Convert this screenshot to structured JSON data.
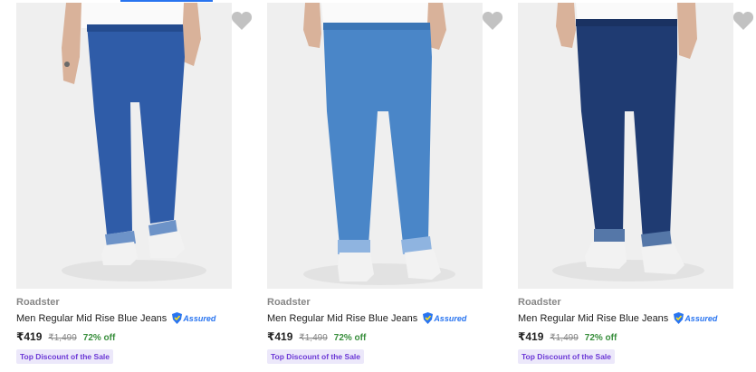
{
  "products": [
    {
      "brand": "Roadster",
      "title": "Men Regular Mid Rise Blue Jeans",
      "assured_label": "Assured",
      "price": "₹419",
      "mrp": "₹1,499",
      "discount": "72% off",
      "badge": "Top Discount of the Sale",
      "jeans_color": "#2f5ca8"
    },
    {
      "brand": "Roadster",
      "title": "Men Regular Mid Rise Blue Jeans",
      "assured_label": "Assured",
      "price": "₹419",
      "mrp": "₹1,499",
      "discount": "72% off",
      "badge": "Top Discount of the Sale",
      "jeans_color": "#4a86c8"
    },
    {
      "brand": "Roadster",
      "title": "Men Regular Mid Rise Blue Jeans",
      "assured_label": "Assured",
      "price": "₹419",
      "mrp": "₹1,499",
      "discount": "72% off",
      "badge": "Top Discount of the Sale",
      "jeans_color": "#1f3b72"
    }
  ],
  "colors": {
    "accent": "#2874f0",
    "discount_green": "#388e3c",
    "badge_bg": "#ece8fa",
    "badge_text": "#6c38d6",
    "wishlist_heart": "#c2c2c2"
  },
  "icons": {
    "wishlist": "heart-icon",
    "assured": "shield-icon"
  }
}
